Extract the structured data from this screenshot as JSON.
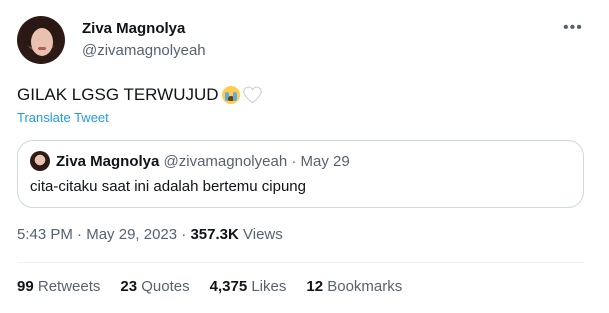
{
  "author": {
    "display_name": "Ziva Magnolya",
    "handle": "@zivamagnolyeah"
  },
  "tweet": {
    "text": "GILAK LGSG TERWUJUD",
    "emojis": [
      "loudly-crying-face",
      "white-heart"
    ],
    "translate_label": "Translate Tweet"
  },
  "quote": {
    "display_name": "Ziva Magnolya",
    "handle": "@zivamagnolyeah",
    "separator": "·",
    "date": "May 29",
    "text": "cita-citaku saat ini adalah bertemu cipung"
  },
  "meta": {
    "time": "5:43 PM",
    "date": "May 29, 2023",
    "separator": "·",
    "views_count": "357.3K",
    "views_label": "Views"
  },
  "stats": [
    {
      "count": "99",
      "label": "Retweets"
    },
    {
      "count": "23",
      "label": "Quotes"
    },
    {
      "count": "4,375",
      "label": "Likes"
    },
    {
      "count": "12",
      "label": "Bookmarks"
    }
  ],
  "colors": {
    "accent": "#1d9bf0",
    "text_primary": "#0f1419",
    "text_secondary": "#536471",
    "border": "#cfd9de"
  }
}
